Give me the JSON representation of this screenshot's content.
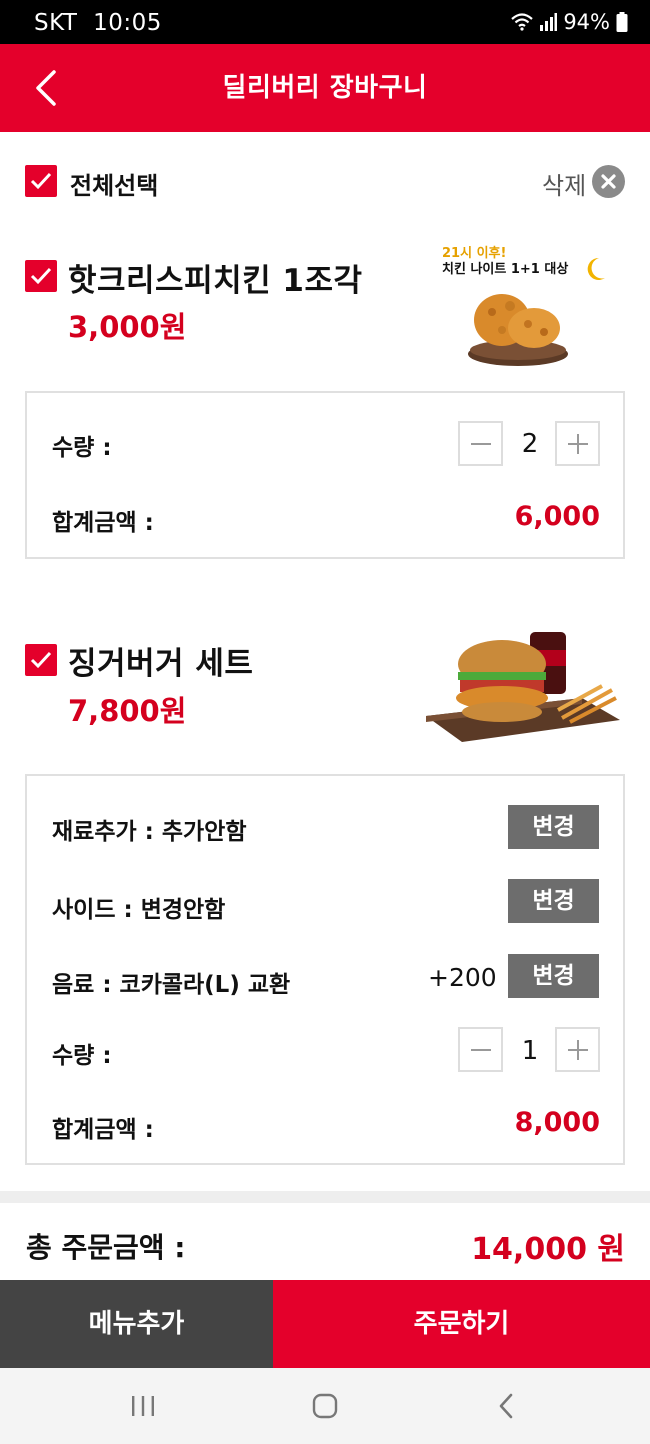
{
  "status": {
    "carrier": "SKT",
    "time": "10:05",
    "battery": "94%"
  },
  "header": {
    "title": "딜리버리 장바구니"
  },
  "select_all": {
    "label": "전체선택",
    "delete_label": "삭제"
  },
  "items": [
    {
      "name": "핫크리스피치킨 1조각",
      "price": "3,000원",
      "image": {
        "badge_line1": "21시 이후!",
        "badge_line2": "치킨 나이트 1+1 대상"
      },
      "quantity_label": "수량 :",
      "quantity": "2",
      "subtotal_label": "합계금액 :",
      "subtotal": "6,000"
    },
    {
      "name": "징거버거 세트",
      "price": "7,800원",
      "options": [
        {
          "label": "재료추가 : 추가안함",
          "extra": "",
          "button": "변경"
        },
        {
          "label": "사이드 : 변경안함",
          "extra": "",
          "button": "변경"
        },
        {
          "label": "음료 : 코카콜라(L) 교환",
          "extra": "+200",
          "button": "변경"
        }
      ],
      "quantity_label": "수량 :",
      "quantity": "1",
      "subtotal_label": "합계금액 :",
      "subtotal": "8,000"
    }
  ],
  "total": {
    "label": "총 주문금액 :",
    "value": "14,000 원"
  },
  "footer": {
    "add_menu": "메뉴추가",
    "order": "주문하기"
  },
  "colors": {
    "brand_red": "#e4002b",
    "price_red": "#d4001e",
    "dark_button": "#444444",
    "option_button": "#6d6d6d"
  },
  "icons": [
    "back-icon",
    "check-icon",
    "close-icon",
    "minus-icon",
    "plus-icon",
    "wifi-icon",
    "signal-icon",
    "battery-icon",
    "recent-apps-icon",
    "home-icon",
    "nav-back-icon"
  ]
}
